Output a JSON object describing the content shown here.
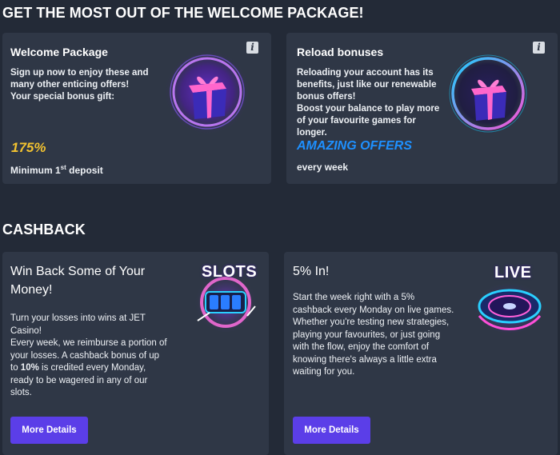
{
  "welcome_section": {
    "title": "GET THE MOST OUT OF THE WELCOME PACKAGE!",
    "cards": [
      {
        "title": "Welcome Package",
        "text": [
          "Sign up now to enjoy these and",
          "many other enticing offers!",
          "Your special bonus gift:"
        ],
        "highlight": "175%",
        "footer_main": "Minimum 1",
        "footer_sup": "st",
        "footer_tail": " deposit",
        "info_icon": "info-icon",
        "illustration": "gift-icon"
      },
      {
        "title": "Reload bonuses",
        "text": [
          "Reloading your account has its",
          "benefits, just like our renewable",
          "bonus offers!",
          "Boost your balance to play more",
          "of your favourite games for",
          "longer."
        ],
        "highlight": "AMAZING OFFERS",
        "footer": "every week",
        "info_icon": "info-icon",
        "illustration": "gift-icon"
      }
    ]
  },
  "cashback_section": {
    "title": "CASHBACK",
    "cards": [
      {
        "title": [
          "Win Back Some of Your",
          "Money!"
        ],
        "text": [
          "Turn your losses into wins at JET",
          "Casino!",
          "Every week, we reimburse a portion of",
          "your losses. A cashback bonus of up",
          "to ",
          "10%",
          " is credited every Monday,",
          "ready to be wagered in any of our",
          "slots."
        ],
        "badge": "SLOTS",
        "button": "More Details"
      },
      {
        "title": [
          "5% In!"
        ],
        "text": [
          "Start the week right with a 5%",
          "cashback every Monday on live games.",
          "Whether you're testing new strategies,",
          "playing your favourites, or just going",
          "with the flow, enjoy the comfort of",
          "knowing there's always a little extra",
          "waiting for you."
        ],
        "badge": "LIVE",
        "button": "More Details"
      }
    ]
  },
  "colors": {
    "background": "#232a37",
    "card": "#2f3746",
    "gold": "#f2c230",
    "blue": "#1e90ff",
    "button": "#5b3ee8"
  }
}
